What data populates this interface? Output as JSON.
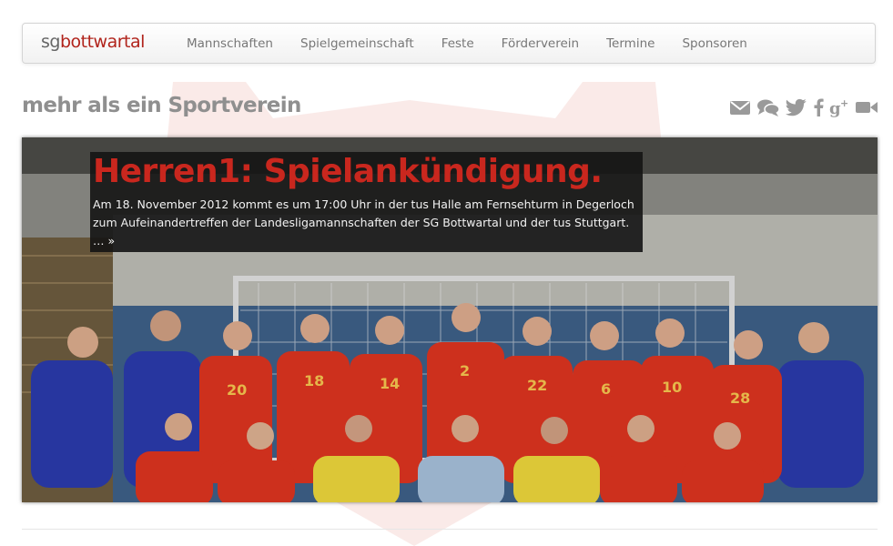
{
  "brand": {
    "part1": "sg",
    "part2": "bottwartal"
  },
  "nav": {
    "items": [
      {
        "label": "Mannschaften"
      },
      {
        "label": "Spielgemeinschaft"
      },
      {
        "label": "Feste"
      },
      {
        "label": "Förderverein"
      },
      {
        "label": "Termine"
      },
      {
        "label": "Sponsoren"
      }
    ]
  },
  "tagline": "mehr als ein Sportverein",
  "social": {
    "icons": [
      "mail-icon",
      "chat-icon",
      "twitter-icon",
      "facebook-icon",
      "google-plus-icon",
      "video-icon"
    ],
    "color": "#9a9a9a"
  },
  "hero": {
    "title": "Herren1: Spielankündigung.",
    "text": "Am 18. November 2012 kommt es um 17:00 Uhr in der tus Halle am Fernsehturm in Degerloch zum Aufeinandertreffen der Landesligamannschaften der SG Bottwartal und der tus Stuttgart. …",
    "more": "»",
    "image": "team-photo"
  },
  "colors": {
    "brand_red": "#b1241c",
    "title_red": "#c9271e",
    "text_gray": "#777777"
  }
}
